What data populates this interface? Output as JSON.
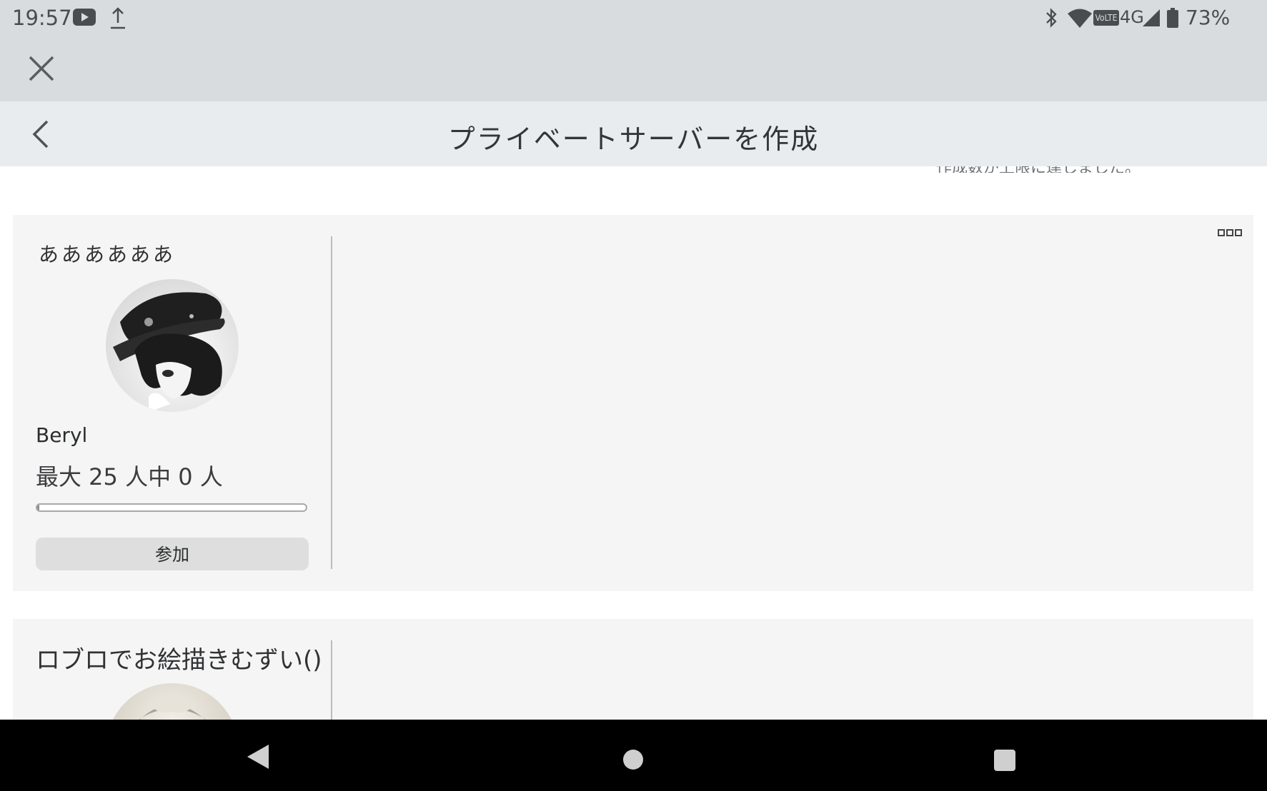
{
  "status_bar": {
    "time": "19:57",
    "network_type": "4G",
    "volte_label": "VoLTE",
    "battery_percent": "73%",
    "icons": [
      "youtube-icon",
      "upload-icon",
      "bluetooth-icon",
      "wifi-icon",
      "volte-icon",
      "signal-icon",
      "battery-icon"
    ]
  },
  "header": {
    "title": "プライベートサーバーを作成",
    "cutoff_notice": "作成数が上限に達しました。"
  },
  "servers": [
    {
      "name": "ああああああ",
      "owner": "Beryl",
      "players": "最大 25 人中 0 人",
      "fill": 0.0,
      "join_label": "参加"
    },
    {
      "name": "ロブロでお絵描きむずい()"
    }
  ],
  "colors": {
    "status_bg": "#d9dcdf",
    "header_bg": "#e9ecee",
    "card_bg": "#f5f5f5",
    "button_bg": "#dedede",
    "nav_bg": "#000000"
  }
}
